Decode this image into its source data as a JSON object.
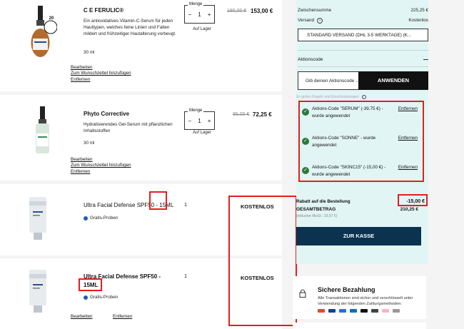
{
  "products": [
    {
      "name": "C E FERULIC®",
      "description": "Ein antioxidatives Vitamin-C-Serum für jeden Hauttypen, welches feine Linien und Falten mildert und frühzeitiger Hautalterung vorbeugt.",
      "size": "30 ml",
      "badge": "20",
      "qty_label": "Menge",
      "qty": "1",
      "stock": "Auf Lager",
      "old_price": "180,00 €",
      "new_price": "153,00 €",
      "links": [
        "Bearbeiten",
        "Zum Wunschzettel hinzufügen",
        "Entfernen"
      ]
    },
    {
      "name": "Phyto Corrective",
      "description": "Hydratisierendes Gel-Serum mit pflanzlichen Inhaltsstoffen",
      "size": "30 ml",
      "qty_label": "Menge",
      "qty": "1",
      "stock": "Auf Lager",
      "old_price": "85,00 €",
      "new_price": "72,25 €",
      "links": [
        "Bearbeiten",
        "Zum Wunschzettel hinzufügen",
        "Entfernen"
      ]
    },
    {
      "name": "Ultra Facial Defense SPF50 - 15ML",
      "sample_label": "Gratis-Proben",
      "qty": "1",
      "price": "KOSTENLOS"
    },
    {
      "name_line1": "Ultra Facial Defense SPF50 -",
      "name_line2": "15ML",
      "sample_label": "Gratis-Proben",
      "qty": "1",
      "price": "KOSTENLOS",
      "links": [
        "Bearbeiten",
        "Entfernen"
      ]
    }
  ],
  "summary": {
    "subtotal_label": "Zwischensumme",
    "subtotal_value": "225,25 €",
    "shipping_label": "Versand",
    "shipping_value": "Kostenlos",
    "shipping_option": "STANDARD VERSAND (DHL 3-5 WERKTAGE) (K...",
    "promo_section_label": "Aktionscode",
    "promo_placeholder": "Gib deinen Aktionscode ...",
    "apply_label": "ANWENDEN",
    "terms_note": "Es gelten Regeln und Einschränkungen",
    "promos": [
      {
        "text": "Aktions-Code \"SERUM\" (-39,75 €) - wurde angewendet",
        "remove": "Entfernen"
      },
      {
        "text": "Aktions-Code \"SONNE\" - wurde angewendet",
        "remove": "Entfernen"
      },
      {
        "text": "Aktions-Code \"SKINC15\" (-15,00 €) - wurde angewendet",
        "remove": "Entfernen"
      }
    ],
    "discount_label": "Rabatt auf die Bestellung",
    "discount_value": "-15,00 €",
    "total_label": "GESAMTBETRAG",
    "total_value": "210,25 €",
    "vat_note": "(inklusive MwSt.: 33,57 €)",
    "checkout_label": "ZUR KASSE"
  },
  "secure": {
    "title": "Sichere Bezahlung",
    "text": "Alle Transaktionen sind sicher und verschlüsselt unter Verwendung der folgenden Zahlungsmethoden:"
  },
  "colors": {
    "accent_dark": "#0b3350",
    "summary_bg": "#e2f5f5",
    "check_green": "#2a7a3b",
    "highlight_red": "#e41e1e"
  }
}
